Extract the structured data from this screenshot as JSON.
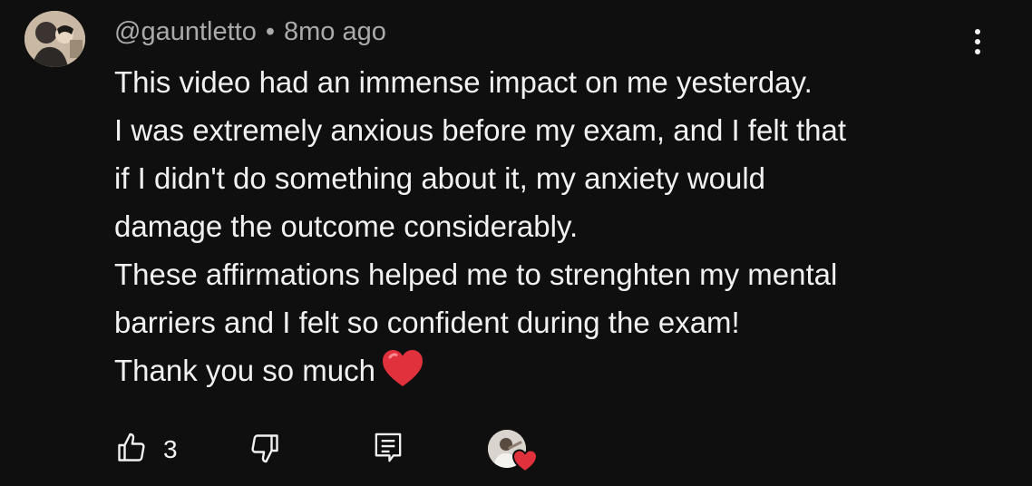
{
  "comment": {
    "author": "@gauntletto",
    "separator": "•",
    "time": "8mo ago",
    "avatar_icon": "user-avatar",
    "menu_icon": "more-vertical-icon",
    "lines": [
      "This video had an immense impact on me yesterday.",
      "I was extremely anxious before my exam, and I felt that",
      "if I didn't do something about it, my anxiety would",
      "damage the outcome considerably.",
      "These affirmations helped me to strenghten my mental",
      "barriers and I felt so confident during the exam!",
      "Thank you so much"
    ],
    "emoji_icon": "red-heart-icon"
  },
  "actions": {
    "like_icon": "thumbs-up-icon",
    "like_count": "3",
    "dislike_icon": "thumbs-down-icon",
    "reply_icon": "reply-icon",
    "creator_heart_icon": "creator-heart-icon"
  },
  "colors": {
    "background": "#0f0f0f",
    "text": "#f1f1f1",
    "secondary_text": "#aaaaaa",
    "heart": "#e0313d"
  }
}
